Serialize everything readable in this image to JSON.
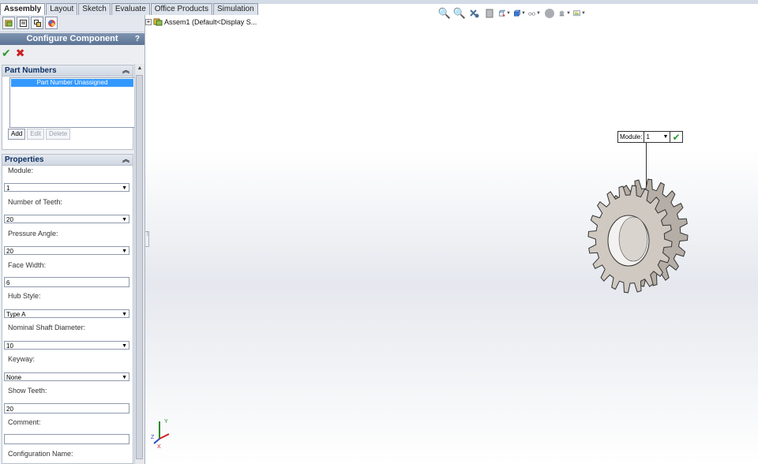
{
  "tabs": [
    {
      "label": "Assembly",
      "active": true
    },
    {
      "label": "Layout",
      "active": false
    },
    {
      "label": "Sketch",
      "active": false
    },
    {
      "label": "Evaluate",
      "active": false
    },
    {
      "label": "Office Products",
      "active": false
    },
    {
      "label": "Simulation",
      "active": false
    }
  ],
  "property_manager": {
    "title": "Configure Component",
    "help": "?"
  },
  "part_numbers": {
    "header": "Part Numbers",
    "selected_item": "Part Number Unassigned",
    "buttons": {
      "add": "Add",
      "edit": "Edit",
      "delete": "Delete"
    }
  },
  "properties": {
    "header": "Properties",
    "fields": {
      "module_label": "Module:",
      "module_value": "1",
      "teeth_label": "Number of Teeth:",
      "teeth_value": "20",
      "pressure_label": "Pressure Angle:",
      "pressure_value": "20",
      "facewidth_label": "Face Width:",
      "facewidth_value": "6",
      "hubstyle_label": "Hub Style:",
      "hubstyle_value": "Type A",
      "shaft_label": "Nominal Shaft Diameter:",
      "shaft_value": "10",
      "keyway_label": "Keyway:",
      "keyway_value": "None",
      "showteeth_label": "Show Teeth:",
      "showteeth_value": "20",
      "comment_label": "Comment:",
      "comment_value": "",
      "configname_label": "Configuration Name:"
    }
  },
  "tree": {
    "root": "Assem1  (Default<Display S..."
  },
  "callout": {
    "label": "Module:",
    "value": "1"
  },
  "triad": {
    "x": "X",
    "y": "Y",
    "z": "Z"
  },
  "colors": {
    "accent": "#5d7495",
    "selection": "#3399ff",
    "ok": "#2f9a2f",
    "cancel": "#cc1f1f",
    "gear": "#cfc9c2"
  }
}
